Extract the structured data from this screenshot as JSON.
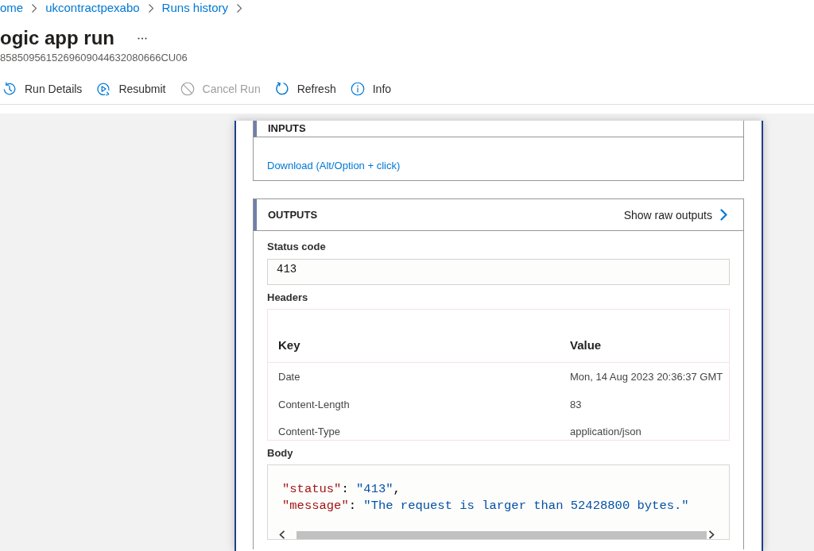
{
  "breadcrumb": [
    {
      "label": "ome"
    },
    {
      "label": "ukcontractpexabo"
    },
    {
      "label": "Runs history"
    }
  ],
  "header": {
    "title": "ogic app run",
    "run_id": "8585095615269609044632080666CU06"
  },
  "toolbar": [
    {
      "label": "Run Details",
      "kind": "history",
      "disabled": false
    },
    {
      "label": "Resubmit",
      "kind": "resubmit",
      "disabled": false
    },
    {
      "label": "Cancel Run",
      "kind": "cancel",
      "disabled": true
    },
    {
      "label": "Refresh",
      "kind": "refresh",
      "disabled": false
    },
    {
      "label": "Info",
      "kind": "info",
      "disabled": false
    }
  ],
  "inputs": {
    "title": "INPUTS",
    "download_link": "Download (Alt/Option + click)"
  },
  "outputs": {
    "title": "OUTPUTS",
    "raw_link": "Show raw outputs",
    "status_code": {
      "label": "Status code",
      "value": "413"
    },
    "headers": {
      "label": "Headers",
      "columns": [
        "Key",
        "Value"
      ],
      "rows": [
        {
          "key": "Date",
          "value": "Mon, 14 Aug 2023 20:36:37 GMT"
        },
        {
          "key": "Content-Length",
          "value": "83"
        },
        {
          "key": "Content-Type",
          "value": "application/json"
        }
      ]
    },
    "body": {
      "label": "Body",
      "lines": [
        {
          "tokens": [
            {
              "kind": "key",
              "text": "\"status\""
            },
            {
              "kind": "punct",
              "text": ": "
            },
            {
              "kind": "string",
              "text": "\"413\""
            },
            {
              "kind": "punct",
              "text": ","
            }
          ]
        },
        {
          "tokens": [
            {
              "kind": "key",
              "text": "\"message\""
            },
            {
              "kind": "punct",
              "text": ": "
            },
            {
              "kind": "string",
              "text": "\"The request is larger than 52428800 bytes.\""
            }
          ]
        }
      ]
    }
  }
}
